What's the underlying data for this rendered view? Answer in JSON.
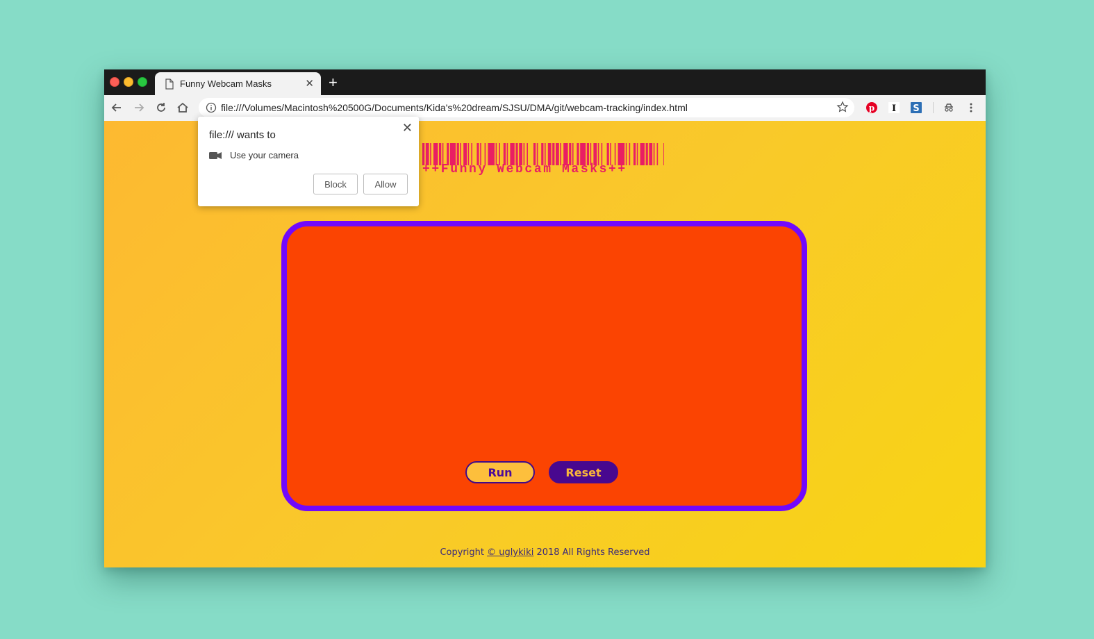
{
  "browser": {
    "tab_title": "Funny Webcam Masks",
    "new_tab_label": "+",
    "url": "file:///Volumes/Macintosh%20500G/Documents/Kida's%20dream/SJSU/DMA/git/webcam-tracking/index.html"
  },
  "page": {
    "subtitle": "++Funny Webcam Masks++",
    "run_label": "Run",
    "reset_label": "Reset",
    "footer": {
      "prefix": "Copyright ",
      "link": "© uglykiki",
      "suffix": " 2018 All Rights Reserved"
    }
  },
  "popup": {
    "title": "file:/// wants to",
    "permission": "Use your camera",
    "block_label": "Block",
    "allow_label": "Allow",
    "close_label": "✕"
  },
  "colors": {
    "background": "#86dcc7",
    "page_gradient_start": "#fdb931",
    "page_gradient_end": "#f8d414",
    "stage_fill": "#fb4402",
    "stage_border": "#7108fc",
    "accent_pink": "#e91e63",
    "reset_button": "#48088f"
  },
  "icons": {
    "back": "arrow-left-icon",
    "forward": "arrow-right-icon",
    "reload": "reload-icon",
    "home": "home-icon",
    "info": "info-icon",
    "star": "star-icon",
    "pinterest": "pinterest-icon",
    "instapaper": "instapaper-icon",
    "stylus": "extension-s-icon",
    "incognito": "incognito-icon",
    "menu": "menu-dots-icon",
    "camera": "camera-icon"
  }
}
